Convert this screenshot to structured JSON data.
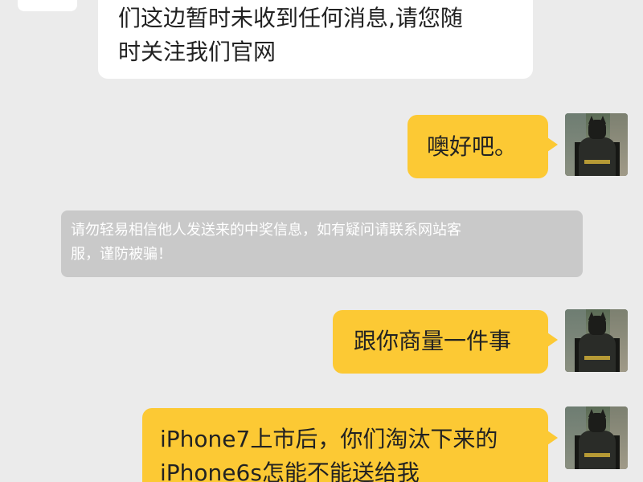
{
  "conversation": {
    "incoming": [
      {
        "text_lines": [
          "们这边暂时未收到任何消息,请您随",
          "时关注我们官网"
        ]
      }
    ],
    "outgoing": [
      {
        "text_lines": [
          "噢好吧。"
        ]
      },
      {
        "text_lines": [
          "跟你商量一件事"
        ]
      },
      {
        "text_lines": [
          "iPhone7上市后，你们淘汰下来的",
          "iPhone6s怎能不能送给我"
        ]
      }
    ],
    "system_notice": {
      "text_lines": [
        "请勿轻易相信他人发送来的中奖信息，如有疑问请联系网站客",
        "服，谨防被骗！"
      ]
    }
  },
  "colors": {
    "background": "#ebebeb",
    "incoming_bubble": "#ffffff",
    "outgoing_bubble": "#fcc934",
    "notice_bubble": "#c9c9c9"
  },
  "icons": {
    "incoming_avatar": "agent-avatar-icon",
    "outgoing_avatar": "batman-avatar-icon"
  }
}
